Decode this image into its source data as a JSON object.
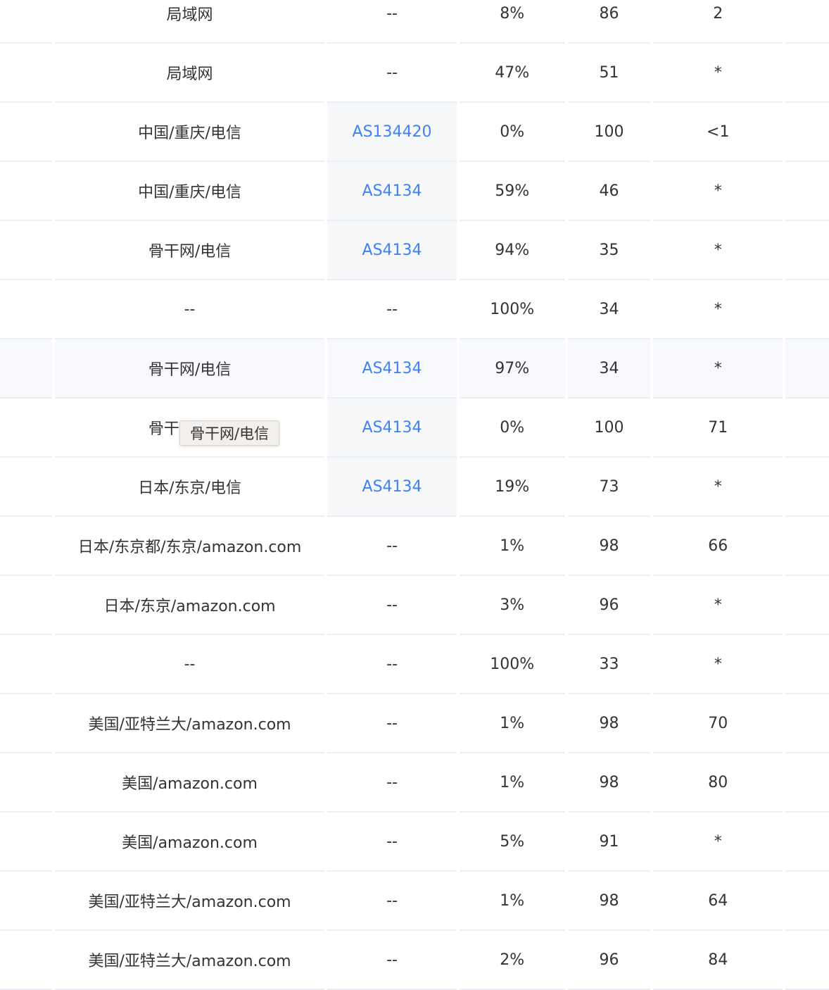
{
  "rows": [
    {
      "location": "局域网",
      "asn": "--",
      "loss": "8%",
      "sent": "86",
      "latency": "2",
      "asn_link": false
    },
    {
      "location": "局域网",
      "asn": "--",
      "loss": "47%",
      "sent": "51",
      "latency": "*",
      "asn_link": false
    },
    {
      "location": "中国/重庆/电信",
      "asn": "AS134420",
      "loss": "0%",
      "sent": "100",
      "latency": "<1",
      "asn_link": true
    },
    {
      "location": "中国/重庆/电信",
      "asn": "AS4134",
      "loss": "59%",
      "sent": "46",
      "latency": "*",
      "asn_link": true
    },
    {
      "location": "骨干网/电信",
      "asn": "AS4134",
      "loss": "94%",
      "sent": "35",
      "latency": "*",
      "asn_link": true
    },
    {
      "location": "--",
      "asn": "--",
      "loss": "100%",
      "sent": "34",
      "latency": "*",
      "asn_link": false
    },
    {
      "location": "骨干网/电信",
      "asn": "AS4134",
      "loss": "97%",
      "sent": "34",
      "latency": "*",
      "asn_link": true,
      "hovered": true
    },
    {
      "location": "骨干网/电信",
      "asn": "AS4134",
      "loss": "0%",
      "sent": "100",
      "latency": "71",
      "asn_link": true
    },
    {
      "location": "日本/东京/电信",
      "asn": "AS4134",
      "loss": "19%",
      "sent": "73",
      "latency": "*",
      "asn_link": true
    },
    {
      "location": "日本/东京都/东京/amazon.com",
      "asn": "--",
      "loss": "1%",
      "sent": "98",
      "latency": "66",
      "asn_link": false
    },
    {
      "location": "日本/东京/amazon.com",
      "asn": "--",
      "loss": "3%",
      "sent": "96",
      "latency": "*",
      "asn_link": false
    },
    {
      "location": "--",
      "asn": "--",
      "loss": "100%",
      "sent": "33",
      "latency": "*",
      "asn_link": false
    },
    {
      "location": "美国/亚特兰大/amazon.com",
      "asn": "--",
      "loss": "1%",
      "sent": "98",
      "latency": "70",
      "asn_link": false
    },
    {
      "location": "美国/amazon.com",
      "asn": "--",
      "loss": "1%",
      "sent": "98",
      "latency": "80",
      "asn_link": false
    },
    {
      "location": "美国/amazon.com",
      "asn": "--",
      "loss": "5%",
      "sent": "91",
      "latency": "*",
      "asn_link": false
    },
    {
      "location": "美国/亚特兰大/amazon.com",
      "asn": "--",
      "loss": "1%",
      "sent": "98",
      "latency": "64",
      "asn_link": false
    },
    {
      "location": "美国/亚特兰大/amazon.com",
      "asn": "--",
      "loss": "2%",
      "sent": "96",
      "latency": "84",
      "asn_link": false
    }
  ],
  "tooltip": {
    "text": "骨干网/电信"
  },
  "colors": {
    "link": "#3e82f7",
    "border": "#ebeef5",
    "asn_bg": "#f6f8fa",
    "hover_bg": "#f7f9fd"
  }
}
